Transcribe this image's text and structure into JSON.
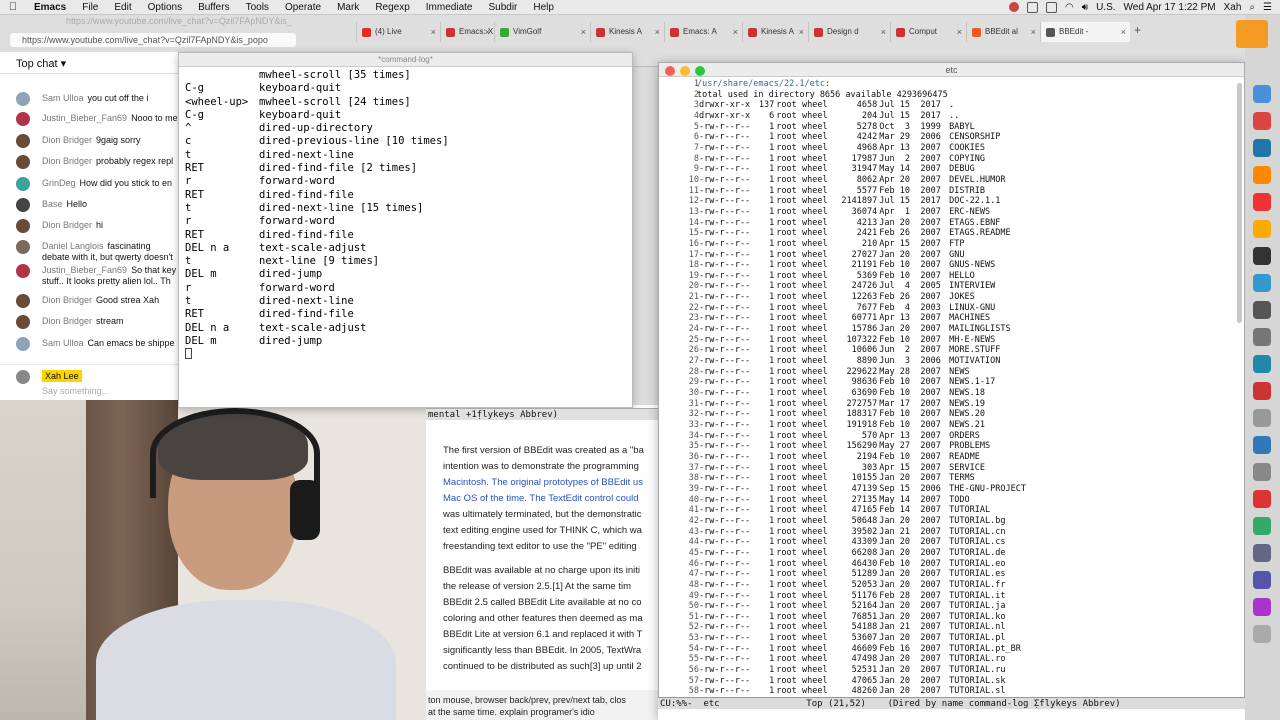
{
  "menubar": {
    "items": [
      "Emacs",
      "File",
      "Edit",
      "Options",
      "Buffers",
      "Tools",
      "Operate",
      "Mark",
      "Regexp",
      "Immediate",
      "Subdir",
      "Help"
    ],
    "status": {
      "lang": "U.S.",
      "datetime": "Wed Apr 17  1:22 PM",
      "user": "Xah"
    }
  },
  "browser": {
    "url_top": "https://www.youtube.com/live_chat?v=Qzil7FApNDY&is_",
    "url": "https://www.youtube.com/live_chat?v=Qzil7FApNDY&is_popo",
    "tabs": [
      {
        "label": "(4) Live",
        "color": "#e52d27"
      },
      {
        "label": "Emacs: X",
        "color": "#c33"
      },
      {
        "label": "VimGolf",
        "color": "#3a3"
      },
      {
        "label": "Kinesis A",
        "color": "#c33"
      },
      {
        "label": "Emacs: A",
        "color": "#c33"
      },
      {
        "label": "Kinesis A",
        "color": "#c33"
      },
      {
        "label": "Design d",
        "color": "#c33"
      },
      {
        "label": "Comput",
        "color": "#c33"
      },
      {
        "label": "BBEdit al",
        "color": "#f05a22"
      },
      {
        "label": "BBEdit -",
        "color": "#555"
      }
    ]
  },
  "chat": {
    "header": "Top chat",
    "messages": [
      {
        "author": "Sam Ulloa",
        "text": "you cut off the i",
        "color": "#8fa3b8"
      },
      {
        "author": "Justin_Bieber_Fan69",
        "text": "Nooo to me",
        "color": "#b0334a"
      },
      {
        "author": "Dion Bridger",
        "text": "9gaig sorry",
        "color": "#6b4a3a"
      },
      {
        "author": "Dion Bridger",
        "text": "probably regex repl",
        "color": "#6b4a3a"
      },
      {
        "author": "GrinDeg",
        "text": "How did you stick to en",
        "color": "#3aa3a0"
      },
      {
        "author": "Base",
        "text": "Hello",
        "color": "#444"
      },
      {
        "author": "Dion Bridger",
        "text": "hi",
        "color": "#6b4a3a"
      },
      {
        "author": "Daniel Langlois",
        "text": "fascinating debate with it, but qwerty doesn't make a",
        "color": "#7a6a5a"
      },
      {
        "author": "Justin_Bieber_Fan69",
        "text": "So that key stuff.. It looks pretty alien lol.. Th",
        "color": "#b0334a"
      },
      {
        "author": "Dion Bridger",
        "text": "Good strea Xah",
        "color": "#6b4a3a"
      },
      {
        "author": "Dion Bridger",
        "text": "stream",
        "color": "#6b4a3a"
      },
      {
        "author": "Sam Ulloa",
        "text": "Can emacs be shippe",
        "color": "#8fa3b8"
      }
    ],
    "current_user": "Xah Lee",
    "placeholder": "Say something..."
  },
  "wiki": {
    "paragraphs": [
      {
        "text": "The first version of BBEdit was created as a \"ba"
      },
      {
        "text": "intention was to demonstrate the programming"
      },
      {
        "text": "Macintosh. The original prototypes of BBEdit us",
        "link": true
      },
      {
        "text": "Mac OS of the time. The TextEdit control could",
        "link": true
      },
      {
        "text": "was ultimately terminated, but the demonstratic"
      },
      {
        "text": "text editing engine used for THINK C, which wa"
      },
      {
        "text": "freestanding text editor to use the \"PE\" editing"
      },
      {
        "text": ""
      },
      {
        "text": "BBEdit was available at no charge upon its initi"
      },
      {
        "text": "the release of version 2.5.[1] At the same tim"
      },
      {
        "text": "BBEdit 2.5 called BBEdit Lite available at no co"
      },
      {
        "text": "coloring and other features then deemed as ma"
      },
      {
        "text": "BBEdit Lite at version 6.1 and replaced it with T"
      },
      {
        "text": "significantly less than BBEdit. In 2005, TextWra"
      },
      {
        "text": "continued to be distributed as such[3] up until 2"
      }
    ],
    "bottom": "ton mouse, browser back/prev, prev/next tab, clos\nat the same time. explain programer's idio"
  },
  "cmdlog": {
    "title": "*command-log*",
    "rows": [
      [
        "",
        "mwheel-scroll [35 times]"
      ],
      [
        "C-g",
        "keyboard-quit"
      ],
      [
        "<wheel-up>",
        "mwheel-scroll [24 times]"
      ],
      [
        "C-g",
        "keyboard-quit"
      ],
      [
        "^",
        "dired-up-directory"
      ],
      [
        "c",
        "dired-previous-line [10 times]"
      ],
      [
        "t",
        "dired-next-line"
      ],
      [
        "RET",
        "dired-find-file [2 times]"
      ],
      [
        "r",
        "forward-word"
      ],
      [
        "RET",
        "dired-find-file"
      ],
      [
        "t",
        "dired-next-line [15 times]"
      ],
      [
        "r",
        "forward-word"
      ],
      [
        "RET",
        "dired-find-file"
      ],
      [
        "DEL n a",
        "text-scale-adjust"
      ],
      [
        "t",
        "next-line [9 times]"
      ],
      [
        "DEL m",
        "dired-jump"
      ],
      [
        "r",
        "forward-word"
      ],
      [
        "t",
        "dired-next-line"
      ],
      [
        "RET",
        "dired-find-file"
      ],
      [
        "DEL n a",
        "text-scale-adjust"
      ],
      [
        "DEL m",
        "dired-jump"
      ]
    ],
    "modeline": "mental +1̣flykeys Abbrev)"
  },
  "dired": {
    "title": "etc",
    "header_path": "/usr/share/emacs/22.1/etc:",
    "total_line": "total used in directory 8656 available 4293696475",
    "rows": [
      [
        "drwxr-xr-x",
        "137",
        "root",
        "wheel",
        "4658",
        "Jul 15",
        " 2017",
        "."
      ],
      [
        "drwxr-xr-x",
        "6",
        "root",
        "wheel",
        "204",
        "Jul 15",
        " 2017",
        ".."
      ],
      [
        "-rw-r--r--",
        "1",
        "root",
        "wheel",
        "5278",
        "Oct  3",
        " 1999",
        "BABYL"
      ],
      [
        "-rw-r--r--",
        "1",
        "root",
        "wheel",
        "4242",
        "Mar 29",
        " 2006",
        "CENSORSHIP"
      ],
      [
        "-rw-r--r--",
        "1",
        "root",
        "wheel",
        "4968",
        "Apr 13",
        " 2007",
        "COOKIES"
      ],
      [
        "-rw-r--r--",
        "1",
        "root",
        "wheel",
        "17987",
        "Jun  2",
        " 2007",
        "COPYING"
      ],
      [
        "-rw-r--r--",
        "1",
        "root",
        "wheel",
        "31947",
        "May 14",
        " 2007",
        "DEBUG"
      ],
      [
        "-rw-r--r--",
        "1",
        "root",
        "wheel",
        "8062",
        "Apr 20",
        " 2007",
        "DEVEL.HUMOR"
      ],
      [
        "-rw-r--r--",
        "1",
        "root",
        "wheel",
        "5577",
        "Feb 10",
        " 2007",
        "DISTRIB"
      ],
      [
        "-rw-r--r--",
        "1",
        "root",
        "wheel",
        "2141897",
        "Jul 15",
        " 2017",
        "DOC-22.1.1"
      ],
      [
        "-rw-r--r--",
        "1",
        "root",
        "wheel",
        "36074",
        "Apr  1",
        " 2007",
        "ERC-NEWS"
      ],
      [
        "-rw-r--r--",
        "1",
        "root",
        "wheel",
        "4213",
        "Jan 20",
        " 2007",
        "ETAGS.EBNF"
      ],
      [
        "-rw-r--r--",
        "1",
        "root",
        "wheel",
        "2421",
        "Feb 26",
        " 2007",
        "ETAGS.README"
      ],
      [
        "-rw-r--r--",
        "1",
        "root",
        "wheel",
        "210",
        "Apr 15",
        " 2007",
        "FTP"
      ],
      [
        "-rw-r--r--",
        "1",
        "root",
        "wheel",
        "27027",
        "Jan 20",
        " 2007",
        "GNU"
      ],
      [
        "-rw-r--r--",
        "1",
        "root",
        "wheel",
        "21191",
        "Feb 10",
        " 2007",
        "GNUS-NEWS"
      ],
      [
        "-rw-r--r--",
        "1",
        "root",
        "wheel",
        "5369",
        "Feb 10",
        " 2007",
        "HELLO"
      ],
      [
        "-rw-r--r--",
        "1",
        "root",
        "wheel",
        "24726",
        "Jul  4",
        " 2005",
        "INTERVIEW"
      ],
      [
        "-rw-r--r--",
        "1",
        "root",
        "wheel",
        "12263",
        "Feb 26",
        " 2007",
        "JOKES"
      ],
      [
        "-rw-r--r--",
        "1",
        "root",
        "wheel",
        "7677",
        "Feb  4",
        " 2003",
        "LINUX-GNU"
      ],
      [
        "-rw-r--r--",
        "1",
        "root",
        "wheel",
        "60771",
        "Apr 13",
        " 2007",
        "MACHINES"
      ],
      [
        "-rw-r--r--",
        "1",
        "root",
        "wheel",
        "15786",
        "Jan 20",
        " 2007",
        "MAILINGLISTS"
      ],
      [
        "-rw-r--r--",
        "1",
        "root",
        "wheel",
        "107322",
        "Feb 10",
        " 2007",
        "MH-E-NEWS"
      ],
      [
        "-rw-r--r--",
        "1",
        "root",
        "wheel",
        "10606",
        "Jun  2",
        " 2007",
        "MORE.STUFF"
      ],
      [
        "-rw-r--r--",
        "1",
        "root",
        "wheel",
        "8890",
        "Jun  3",
        " 2006",
        "MOTIVATION"
      ],
      [
        "-rw-r--r--",
        "1",
        "root",
        "wheel",
        "229622",
        "May 28",
        " 2007",
        "NEWS"
      ],
      [
        "-rw-r--r--",
        "1",
        "root",
        "wheel",
        "98636",
        "Feb 10",
        " 2007",
        "NEWS.1-17"
      ],
      [
        "-rw-r--r--",
        "1",
        "root",
        "wheel",
        "63690",
        "Feb 10",
        " 2007",
        "NEWS.18"
      ],
      [
        "-rw-r--r--",
        "1",
        "root",
        "wheel",
        "272757",
        "Mar 17",
        " 2007",
        "NEWS.19"
      ],
      [
        "-rw-r--r--",
        "1",
        "root",
        "wheel",
        "188317",
        "Feb 10",
        " 2007",
        "NEWS.20"
      ],
      [
        "-rw-r--r--",
        "1",
        "root",
        "wheel",
        "191918",
        "Feb 10",
        " 2007",
        "NEWS.21"
      ],
      [
        "-rw-r--r--",
        "1",
        "root",
        "wheel",
        "570",
        "Apr 13",
        " 2007",
        "ORDERS"
      ],
      [
        "-rw-r--r--",
        "1",
        "root",
        "wheel",
        "156290",
        "May 27",
        " 2007",
        "PROBLEMS"
      ],
      [
        "-rw-r--r--",
        "1",
        "root",
        "wheel",
        "2194",
        "Feb 10",
        " 2007",
        "README"
      ],
      [
        "-rw-r--r--",
        "1",
        "root",
        "wheel",
        "303",
        "Apr 15",
        " 2007",
        "SERVICE"
      ],
      [
        "-rw-r--r--",
        "1",
        "root",
        "wheel",
        "10155",
        "Jan 20",
        " 2007",
        "TERMS"
      ],
      [
        "-rw-r--r--",
        "1",
        "root",
        "wheel",
        "47139",
        "Sep 15",
        " 2006",
        "THE-GNU-PROJECT"
      ],
      [
        "-rw-r--r--",
        "1",
        "root",
        "wheel",
        "27135",
        "May 14",
        " 2007",
        "TODO"
      ],
      [
        "-rw-r--r--",
        "1",
        "root",
        "wheel",
        "47165",
        "Feb 14",
        " 2007",
        "TUTORIAL"
      ],
      [
        "-rw-r--r--",
        "1",
        "root",
        "wheel",
        "50648",
        "Jan 20",
        " 2007",
        "TUTORIAL.bg"
      ],
      [
        "-rw-r--r--",
        "1",
        "root",
        "wheel",
        "39502",
        "Jan 21",
        " 2007",
        "TUTORIAL.cn"
      ],
      [
        "-rw-r--r--",
        "1",
        "root",
        "wheel",
        "43309",
        "Jan 20",
        " 2007",
        "TUTORIAL.cs"
      ],
      [
        "-rw-r--r--",
        "1",
        "root",
        "wheel",
        "66208",
        "Jan 20",
        " 2007",
        "TUTORIAL.de"
      ],
      [
        "-rw-r--r--",
        "1",
        "root",
        "wheel",
        "46430",
        "Feb 10",
        " 2007",
        "TUTORIAL.eo"
      ],
      [
        "-rw-r--r--",
        "1",
        "root",
        "wheel",
        "51289",
        "Jan 20",
        " 2007",
        "TUTORIAL.es"
      ],
      [
        "-rw-r--r--",
        "1",
        "root",
        "wheel",
        "52053",
        "Jan 20",
        " 2007",
        "TUTORIAL.fr"
      ],
      [
        "-rw-r--r--",
        "1",
        "root",
        "wheel",
        "51176",
        "Feb 28",
        " 2007",
        "TUTORIAL.it"
      ],
      [
        "-rw-r--r--",
        "1",
        "root",
        "wheel",
        "52164",
        "Jan 20",
        " 2007",
        "TUTORIAL.ja"
      ],
      [
        "-rw-r--r--",
        "1",
        "root",
        "wheel",
        "76851",
        "Jan 20",
        " 2007",
        "TUTORIAL.ko"
      ],
      [
        "-rw-r--r--",
        "1",
        "root",
        "wheel",
        "54188",
        "Jan 21",
        " 2007",
        "TUTORIAL.nl"
      ],
      [
        "-rw-r--r--",
        "1",
        "root",
        "wheel",
        "53607",
        "Jan 20",
        " 2007",
        "TUTORIAL.pl"
      ],
      [
        "-rw-r--r--",
        "1",
        "root",
        "wheel",
        "46609",
        "Feb 16",
        " 2007",
        "TUTORIAL.pt_BR"
      ],
      [
        "-rw-r--r--",
        "1",
        "root",
        "wheel",
        "47498",
        "Jan 20",
        " 2007",
        "TUTORIAL.ro"
      ],
      [
        "-rw-r--r--",
        "1",
        "root",
        "wheel",
        "52531",
        "Jan 20",
        " 2007",
        "TUTORIAL.ru"
      ],
      [
        "-rw-r--r--",
        "1",
        "root",
        "wheel",
        "47065",
        "Jan 20",
        " 2007",
        "TUTORIAL.sk"
      ],
      [
        "-rw-r--r--",
        "1",
        "root",
        "wheel",
        "48260",
        "Jan 20",
        " 2007",
        "TUTORIAL.sl"
      ]
    ],
    "modeline": "CU:%%-  etc                Top (21,52)    (Dired by name command-log ̣Σflykeys Abbrev)"
  }
}
